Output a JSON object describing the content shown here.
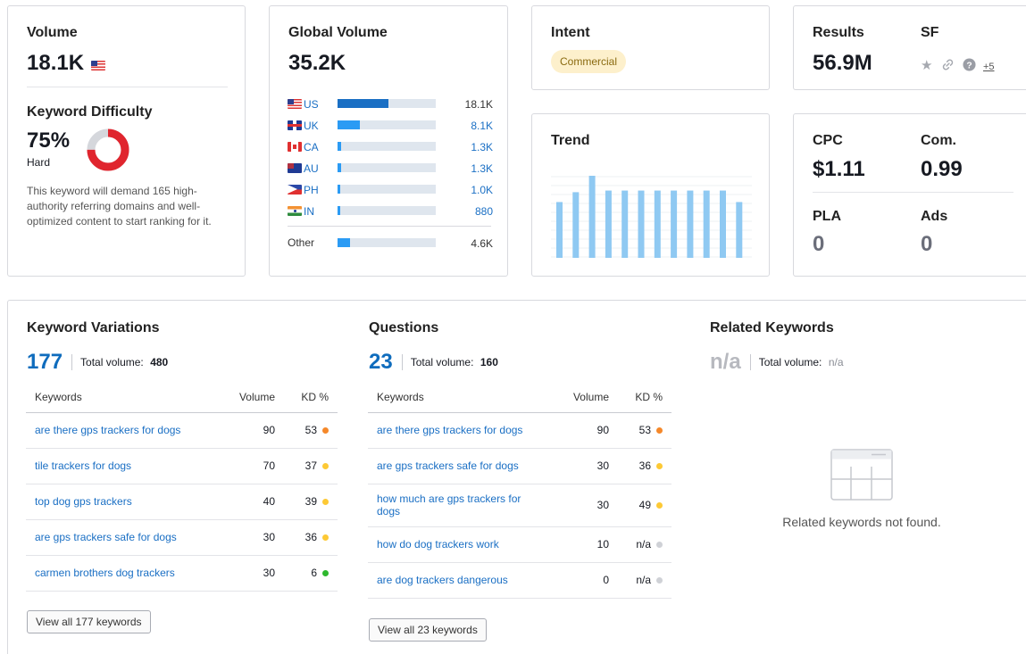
{
  "volume": {
    "label": "Volume",
    "value": "18.1K"
  },
  "kd": {
    "label": "Keyword Difficulty",
    "percent": "75%",
    "percent_value": 75,
    "level": "Hard",
    "description": "This keyword will demand 165 high-authority referring domains and well-optimized content to start ranking for it."
  },
  "global_volume": {
    "label": "Global Volume",
    "value": "35.2K",
    "countries": [
      {
        "code": "US",
        "flag": "flag-us",
        "value": "18.1K",
        "share": 0.52
      },
      {
        "code": "UK",
        "flag": "flag-uk",
        "value": "8.1K",
        "share": 0.23
      },
      {
        "code": "CA",
        "flag": "flag-ca",
        "value": "1.3K",
        "share": 0.035
      },
      {
        "code": "AU",
        "flag": "flag-au",
        "value": "1.3K",
        "share": 0.035
      },
      {
        "code": "PH",
        "flag": "flag-ph",
        "value": "1.0K",
        "share": 0.03
      },
      {
        "code": "IN",
        "flag": "flag-in",
        "value": "880",
        "share": 0.025
      }
    ],
    "other": {
      "label": "Other",
      "value": "4.6K",
      "share": 0.13
    }
  },
  "intent": {
    "label": "Intent",
    "badge": "Commercial"
  },
  "trend": {
    "label": "Trend",
    "values": [
      0.68,
      0.8,
      1.0,
      0.82,
      0.82,
      0.82,
      0.82,
      0.82,
      0.82,
      0.82,
      0.82,
      0.68
    ]
  },
  "results": {
    "label": "Results",
    "value": "56.9M"
  },
  "sf": {
    "label": "SF",
    "more": "+5",
    "icons": [
      "star-icon",
      "link-icon",
      "question-icon"
    ]
  },
  "cpc": {
    "label": "CPC",
    "value": "$1.11"
  },
  "com": {
    "label": "Com.",
    "value": "0.99"
  },
  "pla": {
    "label": "PLA",
    "value": "0"
  },
  "ads": {
    "label": "Ads",
    "value": "0"
  },
  "variations": {
    "title": "Keyword Variations",
    "count": "177",
    "total_label": "Total volume:",
    "total": "480",
    "col_keywords": "Keywords",
    "col_volume": "Volume",
    "col_kd": "KD %",
    "rows": [
      {
        "kw": "are there gps trackers for dogs",
        "vol": "90",
        "kd": "53",
        "color": "#f5882a"
      },
      {
        "kw": "tile trackers for dogs",
        "vol": "70",
        "kd": "37",
        "color": "#fdc935"
      },
      {
        "kw": "top dog gps trackers",
        "vol": "40",
        "kd": "39",
        "color": "#fdc935"
      },
      {
        "kw": "are gps trackers safe for dogs",
        "vol": "30",
        "kd": "36",
        "color": "#fdc935"
      },
      {
        "kw": "carmen brothers dog trackers",
        "vol": "30",
        "kd": "6",
        "color": "#2eb82e"
      }
    ],
    "button": "View all 177 keywords"
  },
  "questions": {
    "title": "Questions",
    "count": "23",
    "total_label": "Total volume:",
    "total": "160",
    "col_keywords": "Keywords",
    "col_volume": "Volume",
    "col_kd": "KD %",
    "rows": [
      {
        "kw": "are there gps trackers for dogs",
        "vol": "90",
        "kd": "53",
        "color": "#f5882a"
      },
      {
        "kw": "are gps trackers safe for dogs",
        "vol": "30",
        "kd": "36",
        "color": "#fdc935"
      },
      {
        "kw": "how much are gps trackers for dogs",
        "vol": "30",
        "kd": "49",
        "color": "#fdc935"
      },
      {
        "kw": "how do dog trackers work",
        "vol": "10",
        "kd": "n/a",
        "color": "#cfd1d6"
      },
      {
        "kw": "are dog trackers dangerous",
        "vol": "0",
        "kd": "n/a",
        "color": "#cfd1d6"
      }
    ],
    "button": "View all 23 keywords"
  },
  "related": {
    "title": "Related Keywords",
    "count": "n/a",
    "total_label": "Total volume:",
    "total": "n/a",
    "empty": "Related keywords not found."
  }
}
